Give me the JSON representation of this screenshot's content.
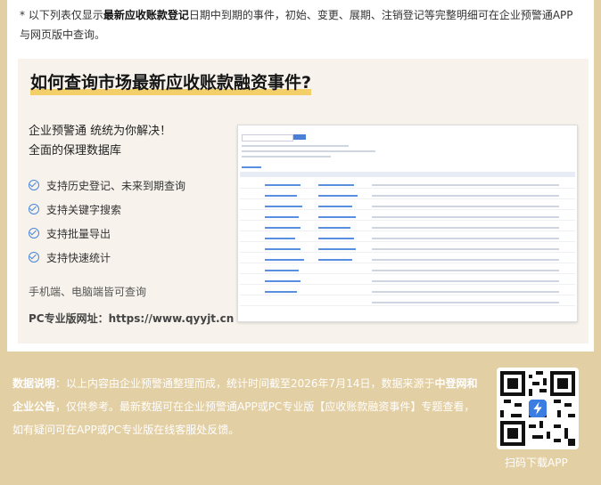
{
  "note": {
    "prefix": "* 以下列表仅显示",
    "bold": "最新应收账款登记",
    "suffix": "日期中到期的事件，初始、变更、展期、注销登记等完整明细可在企业预警通APP与网页版中查询。"
  },
  "promo": {
    "title": "如何查询市场最新应收账款融资事件?",
    "subtitle1": "企业预警通 统统为你解决！",
    "subtitle2": "全面的保理数据库",
    "features": [
      "支持历史登记、未来到期查询",
      "支持关键字搜索",
      "支持批量导出",
      "支持快速统计"
    ],
    "mobile_note": "手机端、电脑端皆可查询",
    "pc_url": "PC专业版网址：https://www.qyyjt.cn"
  },
  "footer": {
    "label": "数据说明",
    "part1": "：以上内容由企业预警通整理而成，统计时间截至2026年7月14日，数据来源于",
    "bold_source": "中登网和企业公告",
    "part2": "，仅供参考。最新数据可在企业预警通APP或PC专业版【应收账款融资事件】专题查看，如有疑问可在APP或PC专业版在线客服处反馈。",
    "qr_label": "扫码下载APP"
  },
  "colors": {
    "background": "#e3cfa4",
    "accent_blue": "#4b86d8",
    "title_highlight": "#f3cf6a"
  },
  "icons": {
    "feature_bullet": "check-circle-icon",
    "qr": "qr-code-icon",
    "app_logo": "lightning-logo-icon"
  }
}
